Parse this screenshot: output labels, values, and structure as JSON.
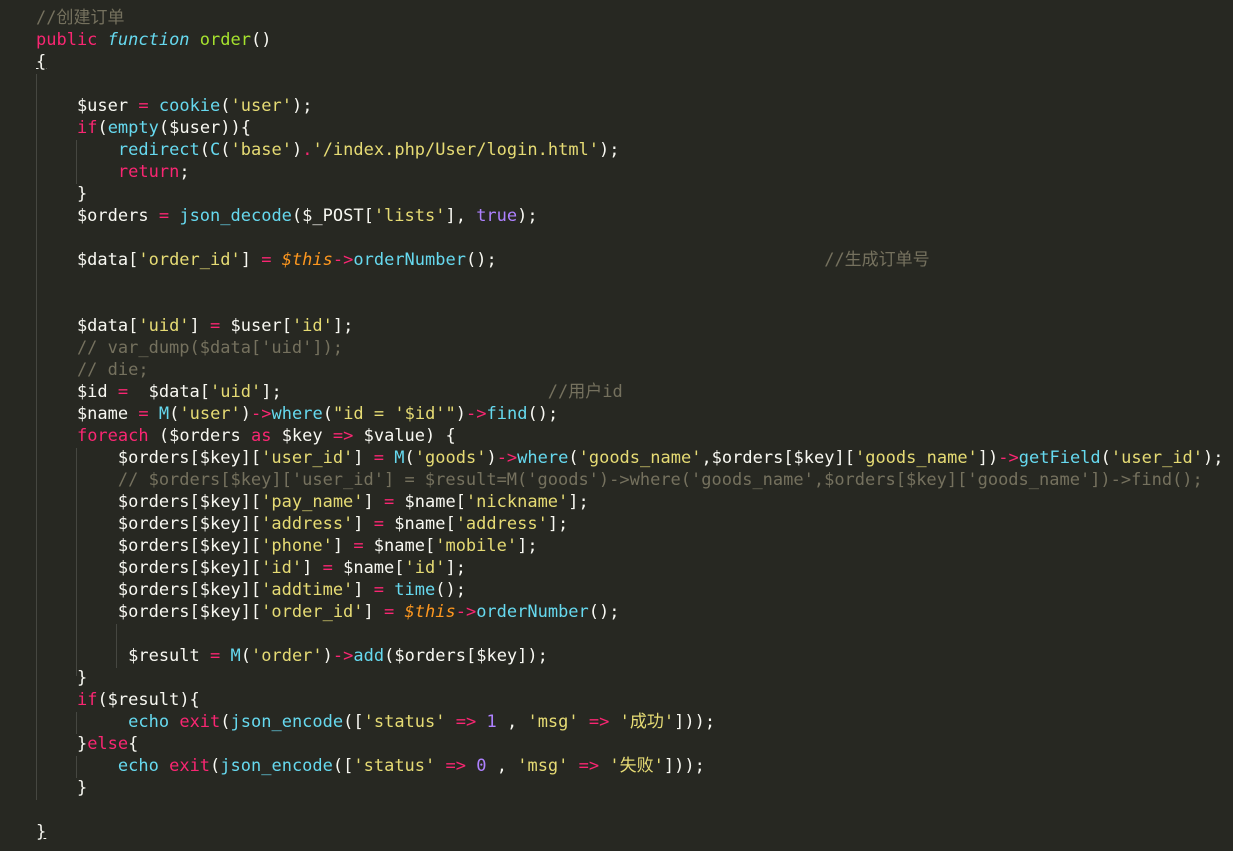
{
  "editor": {
    "theme": "monokai",
    "colors": {
      "background": "#272822",
      "comment": "#75715e",
      "keyword": "#f92672",
      "function": "#a6e22e",
      "support": "#66d9ef",
      "string": "#e6db74",
      "number": "#ae81ff",
      "this": "#fd971f",
      "text": "#f8f8f2"
    },
    "lines": [
      [
        {
          "t": "//创建订单",
          "c": "comment"
        }
      ],
      [
        {
          "t": "public ",
          "c": "kw"
        },
        {
          "t": "function",
          "c": "storage"
        },
        {
          "t": " ",
          "c": "plain"
        },
        {
          "t": "order",
          "c": "fn"
        },
        {
          "t": "()",
          "c": "plain"
        }
      ],
      [
        {
          "t": "{",
          "c": "under"
        }
      ],
      [],
      [
        {
          "t": "    $user ",
          "c": "plain"
        },
        {
          "t": "=",
          "c": "op"
        },
        {
          "t": " ",
          "c": "plain"
        },
        {
          "t": "cookie",
          "c": "support"
        },
        {
          "t": "(",
          "c": "plain"
        },
        {
          "t": "'user'",
          "c": "str"
        },
        {
          "t": ");",
          "c": "plain"
        }
      ],
      [
        {
          "t": "    ",
          "c": "plain"
        },
        {
          "t": "if",
          "c": "kw"
        },
        {
          "t": "(",
          "c": "plain"
        },
        {
          "t": "empty",
          "c": "support"
        },
        {
          "t": "($user)){",
          "c": "plain"
        }
      ],
      [
        {
          "t": "        ",
          "c": "plain"
        },
        {
          "t": "redirect",
          "c": "support"
        },
        {
          "t": "(",
          "c": "plain"
        },
        {
          "t": "C",
          "c": "support"
        },
        {
          "t": "(",
          "c": "plain"
        },
        {
          "t": "'base'",
          "c": "str"
        },
        {
          "t": ")",
          "c": "plain"
        },
        {
          "t": ".",
          "c": "op"
        },
        {
          "t": "'/index.php/User/login.html'",
          "c": "str"
        },
        {
          "t": ");",
          "c": "plain"
        }
      ],
      [
        {
          "t": "        ",
          "c": "plain"
        },
        {
          "t": "return",
          "c": "kw"
        },
        {
          "t": ";",
          "c": "plain"
        }
      ],
      [
        {
          "t": "    }",
          "c": "plain"
        }
      ],
      [
        {
          "t": "    $orders ",
          "c": "plain"
        },
        {
          "t": "=",
          "c": "op"
        },
        {
          "t": " ",
          "c": "plain"
        },
        {
          "t": "json_decode",
          "c": "support"
        },
        {
          "t": "($_POST[",
          "c": "plain"
        },
        {
          "t": "'lists'",
          "c": "str"
        },
        {
          "t": "], ",
          "c": "plain"
        },
        {
          "t": "true",
          "c": "const"
        },
        {
          "t": ");",
          "c": "plain"
        }
      ],
      [],
      [
        {
          "t": "    $data[",
          "c": "plain"
        },
        {
          "t": "'order_id'",
          "c": "str"
        },
        {
          "t": "] ",
          "c": "plain"
        },
        {
          "t": "=",
          "c": "op"
        },
        {
          "t": " ",
          "c": "plain"
        },
        {
          "t": "$this",
          "c": "this"
        },
        {
          "t": "->",
          "c": "op"
        },
        {
          "t": "orderNumber",
          "c": "support"
        },
        {
          "t": "();                                //生成订单号",
          "c": "plain",
          "split": true
        }
      ],
      [],
      [],
      [
        {
          "t": "    $data[",
          "c": "plain"
        },
        {
          "t": "'uid'",
          "c": "str"
        },
        {
          "t": "] ",
          "c": "plain"
        },
        {
          "t": "=",
          "c": "op"
        },
        {
          "t": " $user[",
          "c": "plain"
        },
        {
          "t": "'id'",
          "c": "str"
        },
        {
          "t": "];",
          "c": "plain"
        }
      ],
      [
        {
          "t": "    // var_dump($data['uid']);",
          "c": "comment"
        }
      ],
      [
        {
          "t": "    // die;",
          "c": "comment"
        }
      ],
      [
        {
          "t": "    $id ",
          "c": "plain"
        },
        {
          "t": "=",
          "c": "op"
        },
        {
          "t": "  $data[",
          "c": "plain"
        },
        {
          "t": "'uid'",
          "c": "str"
        },
        {
          "t": "];                          ",
          "c": "plain"
        },
        {
          "t": "//用户id",
          "c": "comment"
        }
      ],
      [
        {
          "t": "    $name ",
          "c": "plain"
        },
        {
          "t": "=",
          "c": "op"
        },
        {
          "t": " ",
          "c": "plain"
        },
        {
          "t": "M",
          "c": "support"
        },
        {
          "t": "(",
          "c": "plain"
        },
        {
          "t": "'user'",
          "c": "str"
        },
        {
          "t": ")",
          "c": "plain"
        },
        {
          "t": "->",
          "c": "op"
        },
        {
          "t": "where",
          "c": "support"
        },
        {
          "t": "(",
          "c": "plain"
        },
        {
          "t": "\"id = '$id'\"",
          "c": "str"
        },
        {
          "t": ")",
          "c": "plain"
        },
        {
          "t": "->",
          "c": "op"
        },
        {
          "t": "find",
          "c": "support"
        },
        {
          "t": "();",
          "c": "plain"
        }
      ],
      [
        {
          "t": "    ",
          "c": "plain"
        },
        {
          "t": "foreach",
          "c": "kw"
        },
        {
          "t": " ($orders ",
          "c": "plain"
        },
        {
          "t": "as",
          "c": "kw"
        },
        {
          "t": " $key ",
          "c": "plain"
        },
        {
          "t": "=>",
          "c": "op"
        },
        {
          "t": " $value) {",
          "c": "plain"
        }
      ],
      [
        {
          "t": "        $orders[$key][",
          "c": "plain"
        },
        {
          "t": "'user_id'",
          "c": "str"
        },
        {
          "t": "] ",
          "c": "plain"
        },
        {
          "t": "=",
          "c": "op"
        },
        {
          "t": " ",
          "c": "plain"
        },
        {
          "t": "M",
          "c": "support"
        },
        {
          "t": "(",
          "c": "plain"
        },
        {
          "t": "'goods'",
          "c": "str"
        },
        {
          "t": ")",
          "c": "plain"
        },
        {
          "t": "->",
          "c": "op"
        },
        {
          "t": "where",
          "c": "support"
        },
        {
          "t": "(",
          "c": "plain"
        },
        {
          "t": "'goods_name'",
          "c": "str"
        },
        {
          "t": ",$orders[$key][",
          "c": "plain"
        },
        {
          "t": "'goods_name'",
          "c": "str"
        },
        {
          "t": "])",
          "c": "plain"
        },
        {
          "t": "->",
          "c": "op"
        },
        {
          "t": "getField",
          "c": "support"
        },
        {
          "t": "(",
          "c": "plain"
        },
        {
          "t": "'user_id'",
          "c": "str"
        },
        {
          "t": ");",
          "c": "plain"
        }
      ],
      [
        {
          "t": "        // $orders[$key]['user_id'] = $result=M('goods')->where('goods_name',$orders[$key]['goods_name'])->find();",
          "c": "comment"
        }
      ],
      [
        {
          "t": "        $orders[$key][",
          "c": "plain"
        },
        {
          "t": "'pay_name'",
          "c": "str"
        },
        {
          "t": "] ",
          "c": "plain"
        },
        {
          "t": "=",
          "c": "op"
        },
        {
          "t": " $name[",
          "c": "plain"
        },
        {
          "t": "'nickname'",
          "c": "str"
        },
        {
          "t": "];",
          "c": "plain"
        }
      ],
      [
        {
          "t": "        $orders[$key][",
          "c": "plain"
        },
        {
          "t": "'address'",
          "c": "str"
        },
        {
          "t": "] ",
          "c": "plain"
        },
        {
          "t": "=",
          "c": "op"
        },
        {
          "t": " $name[",
          "c": "plain"
        },
        {
          "t": "'address'",
          "c": "str"
        },
        {
          "t": "];",
          "c": "plain"
        }
      ],
      [
        {
          "t": "        $orders[$key][",
          "c": "plain"
        },
        {
          "t": "'phone'",
          "c": "str"
        },
        {
          "t": "] ",
          "c": "plain"
        },
        {
          "t": "=",
          "c": "op"
        },
        {
          "t": " $name[",
          "c": "plain"
        },
        {
          "t": "'mobile'",
          "c": "str"
        },
        {
          "t": "];",
          "c": "plain"
        }
      ],
      [
        {
          "t": "        $orders[$key][",
          "c": "plain"
        },
        {
          "t": "'id'",
          "c": "str"
        },
        {
          "t": "] ",
          "c": "plain"
        },
        {
          "t": "=",
          "c": "op"
        },
        {
          "t": " $name[",
          "c": "plain"
        },
        {
          "t": "'id'",
          "c": "str"
        },
        {
          "t": "];",
          "c": "plain"
        }
      ],
      [
        {
          "t": "        $orders[$key][",
          "c": "plain"
        },
        {
          "t": "'addtime'",
          "c": "str"
        },
        {
          "t": "] ",
          "c": "plain"
        },
        {
          "t": "=",
          "c": "op"
        },
        {
          "t": " ",
          "c": "plain"
        },
        {
          "t": "time",
          "c": "support"
        },
        {
          "t": "();",
          "c": "plain"
        }
      ],
      [
        {
          "t": "        $orders[$key][",
          "c": "plain"
        },
        {
          "t": "'order_id'",
          "c": "str"
        },
        {
          "t": "] ",
          "c": "plain"
        },
        {
          "t": "=",
          "c": "op"
        },
        {
          "t": " ",
          "c": "plain"
        },
        {
          "t": "$this",
          "c": "this"
        },
        {
          "t": "->",
          "c": "op"
        },
        {
          "t": "orderNumber",
          "c": "support"
        },
        {
          "t": "();",
          "c": "plain"
        }
      ],
      [],
      [
        {
          "t": "         $result ",
          "c": "plain"
        },
        {
          "t": "=",
          "c": "op"
        },
        {
          "t": " ",
          "c": "plain"
        },
        {
          "t": "M",
          "c": "support"
        },
        {
          "t": "(",
          "c": "plain"
        },
        {
          "t": "'order'",
          "c": "str"
        },
        {
          "t": ")",
          "c": "plain"
        },
        {
          "t": "->",
          "c": "op"
        },
        {
          "t": "add",
          "c": "support"
        },
        {
          "t": "($orders[$key]);",
          "c": "plain"
        }
      ],
      [
        {
          "t": "    }",
          "c": "plain"
        }
      ],
      [
        {
          "t": "    ",
          "c": "plain"
        },
        {
          "t": "if",
          "c": "kw"
        },
        {
          "t": "($result){",
          "c": "plain"
        }
      ],
      [
        {
          "t": "         ",
          "c": "plain"
        },
        {
          "t": "echo",
          "c": "support"
        },
        {
          "t": " ",
          "c": "plain"
        },
        {
          "t": "exit",
          "c": "kw"
        },
        {
          "t": "(",
          "c": "plain"
        },
        {
          "t": "json_encode",
          "c": "support"
        },
        {
          "t": "([",
          "c": "plain"
        },
        {
          "t": "'status'",
          "c": "str"
        },
        {
          "t": " ",
          "c": "plain"
        },
        {
          "t": "=>",
          "c": "op"
        },
        {
          "t": " ",
          "c": "plain"
        },
        {
          "t": "1",
          "c": "num"
        },
        {
          "t": " , ",
          "c": "plain"
        },
        {
          "t": "'msg'",
          "c": "str"
        },
        {
          "t": " ",
          "c": "plain"
        },
        {
          "t": "=>",
          "c": "op"
        },
        {
          "t": " ",
          "c": "plain"
        },
        {
          "t": "'成功'",
          "c": "str"
        },
        {
          "t": "]));",
          "c": "plain"
        }
      ],
      [
        {
          "t": "    }",
          "c": "plain"
        },
        {
          "t": "else",
          "c": "kw"
        },
        {
          "t": "{",
          "c": "plain"
        }
      ],
      [
        {
          "t": "        ",
          "c": "plain"
        },
        {
          "t": "echo",
          "c": "support"
        },
        {
          "t": " ",
          "c": "plain"
        },
        {
          "t": "exit",
          "c": "kw"
        },
        {
          "t": "(",
          "c": "plain"
        },
        {
          "t": "json_encode",
          "c": "support"
        },
        {
          "t": "([",
          "c": "plain"
        },
        {
          "t": "'status'",
          "c": "str"
        },
        {
          "t": " ",
          "c": "plain"
        },
        {
          "t": "=>",
          "c": "op"
        },
        {
          "t": " ",
          "c": "plain"
        },
        {
          "t": "0",
          "c": "num"
        },
        {
          "t": " , ",
          "c": "plain"
        },
        {
          "t": "'msg'",
          "c": "str"
        },
        {
          "t": " ",
          "c": "plain"
        },
        {
          "t": "=>",
          "c": "op"
        },
        {
          "t": " ",
          "c": "plain"
        },
        {
          "t": "'失败'",
          "c": "str"
        },
        {
          "t": "]));",
          "c": "plain"
        }
      ],
      [
        {
          "t": "    }",
          "c": "plain"
        }
      ],
      [],
      [
        {
          "t": "}",
          "c": "under"
        }
      ]
    ]
  }
}
